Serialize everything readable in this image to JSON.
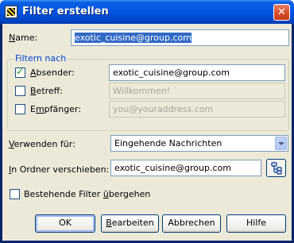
{
  "window": {
    "title": "Filter erstellen",
    "close_glyph": "✕"
  },
  "name": {
    "label_ul": "N",
    "label_rest": "ame:",
    "value": "exotic_cuisine@group.com"
  },
  "group": {
    "title": "Filtern nach",
    "rows": [
      {
        "label_ul": "A",
        "label_rest": "bsender:",
        "checked": true,
        "value": "exotic_cuisine@group.com",
        "disabled": false
      },
      {
        "label_ul": "B",
        "label_rest": "etreff:",
        "checked": false,
        "value": "Willkommen!",
        "disabled": true
      },
      {
        "label_pre": "E",
        "label_ul": "m",
        "label_rest": "pfänger:",
        "checked": false,
        "value": "you@youraddress.com",
        "disabled": true
      }
    ]
  },
  "use_for": {
    "label_ul": "V",
    "label_rest": "erwenden für:",
    "selected": "Eingehende Nachrichten"
  },
  "move_to": {
    "label_ul": "I",
    "label_rest": "n Ordner verschieben:",
    "value": "exotic_cuisine@group.com"
  },
  "override": {
    "label_pre": "Bestehende Filter ",
    "label_ul": "ü",
    "label_rest": "bergehen",
    "checked": false
  },
  "buttons": {
    "ok": "OK",
    "edit_ul": "B",
    "edit_rest": "earbeiten",
    "cancel": "Abbrechen",
    "help": "Hilfe"
  }
}
